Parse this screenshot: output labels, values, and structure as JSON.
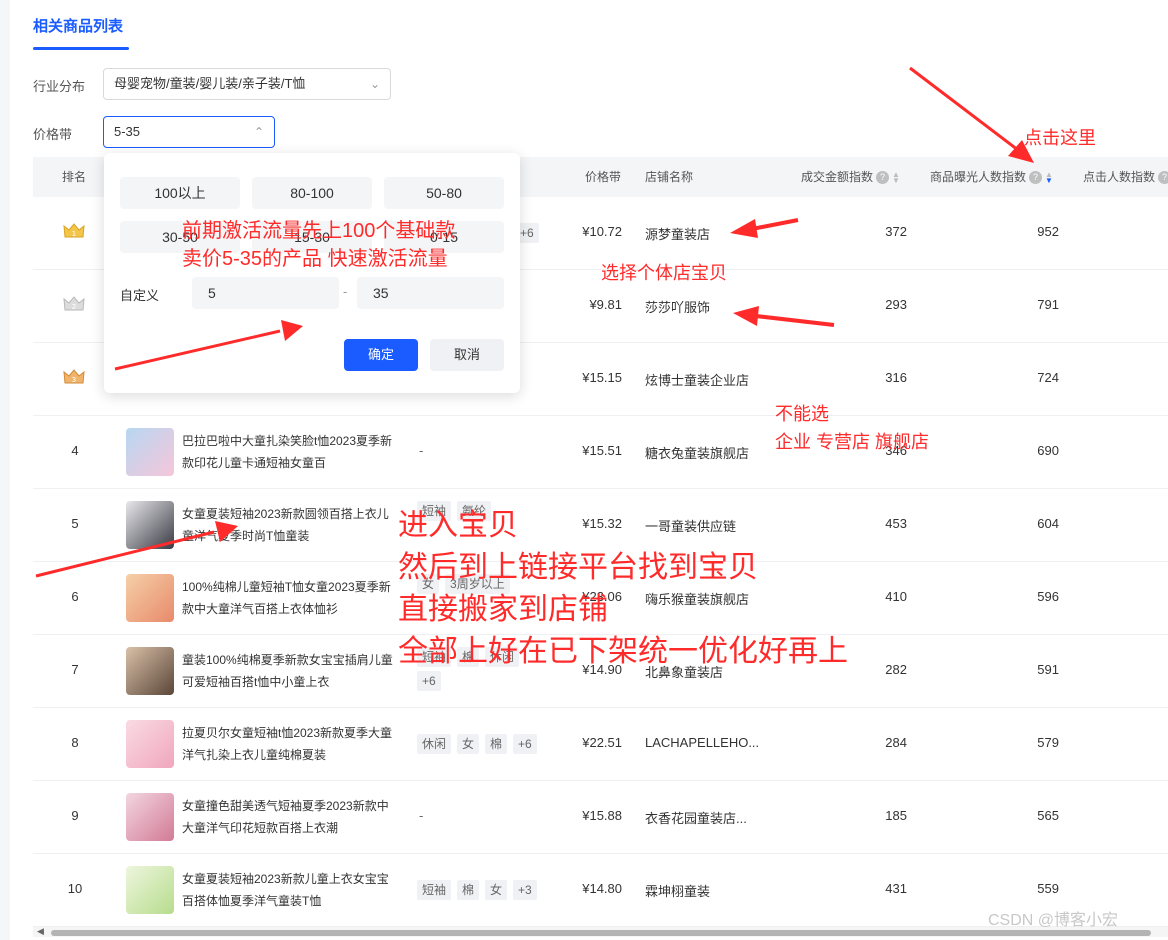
{
  "tab": {
    "label": "相关商品列表"
  },
  "filters": {
    "industry": {
      "label": "行业分布",
      "value": "母婴宠物/童装/婴儿装/亲子装/T恤"
    },
    "price": {
      "label": "价格带",
      "value": "5-35"
    }
  },
  "columns": {
    "rank": "排名",
    "price": "价格带",
    "shop": "店铺名称",
    "gmv": "成交金额指数",
    "exposure": "商品曝光人数指数",
    "clicks": "点击人数指数"
  },
  "rows": [
    {
      "rank": "1",
      "title": "",
      "tags": [
        "+6"
      ],
      "price": "¥10.72",
      "shop": "源梦童装店",
      "gmv": "372",
      "exposure": "952"
    },
    {
      "rank": "2",
      "title": "",
      "tags": [],
      "price": "¥9.81",
      "shop": "莎莎吖服饰",
      "gmv": "293",
      "exposure": "791"
    },
    {
      "rank": "3",
      "title": "",
      "tags": [],
      "price": "¥15.15",
      "shop": "炫博士童装企业店",
      "gmv": "316",
      "exposure": "724"
    },
    {
      "rank": "4",
      "title": "巴拉巴啦中大童扎染笑脸t恤2023夏季新款印花儿童卡通短袖女童百",
      "tags": [],
      "price": "¥15.51",
      "shop": "糖衣兔童装旗舰店",
      "gmv": "346",
      "exposure": "690"
    },
    {
      "rank": "5",
      "title": "女童夏装短袖2023新款圆领百搭上衣儿童洋气夏季时尚T恤童装",
      "tags": [
        "短袖",
        "氨纶"
      ],
      "price": "¥15.32",
      "shop": "一哥童装供应链",
      "gmv": "453",
      "exposure": "604"
    },
    {
      "rank": "6",
      "title": "100%纯棉儿童短袖T恤女童2023夏季新款中大童洋气百搭上衣体恤衫",
      "tags": [
        "女",
        "3周岁以上"
      ],
      "price": "¥23.06",
      "shop": "嗨乐猴童装旗舰店",
      "gmv": "410",
      "exposure": "596"
    },
    {
      "rank": "7",
      "title": "童装100%纯棉夏季新款女宝宝插肩儿童可爱短袖百搭t恤中小童上衣",
      "tags": [
        "短袖",
        "棉",
        "休闲"
      ],
      "price": "¥14.90",
      "shop": "北鼻象童装店",
      "gmv": "282",
      "exposure": "591"
    },
    {
      "rank": "8",
      "title": "拉夏贝尔女童短袖t恤2023新款夏季大童洋气扎染上衣儿童纯棉夏装",
      "tags": [
        "休闲",
        "女",
        "棉",
        "+6"
      ],
      "price": "¥22.51",
      "shop": "LACHAPELLEHO...",
      "gmv": "284",
      "exposure": "579"
    },
    {
      "rank": "9",
      "title": "女童撞色甜美透气短袖夏季2023新款中大童洋气印花短款百搭上衣潮",
      "tags": [],
      "price": "¥15.88",
      "shop": "衣香花园童装店...",
      "gmv": "185",
      "exposure": "565"
    },
    {
      "rank": "10",
      "title": "女童夏装短袖2023新款儿童上衣女宝宝百搭体恤夏季洋气童装T恤",
      "tags": [
        "短袖",
        "棉",
        "女",
        "+3"
      ],
      "price": "¥14.80",
      "shop": "霖坤栩童装",
      "gmv": "431",
      "exposure": "559"
    }
  ],
  "price_popup": {
    "options": [
      "100以上",
      "80-100",
      "50-80",
      "30-50",
      "15-30",
      "0-15"
    ],
    "custom_label": "自定义",
    "min_value": "5",
    "max_value": "35",
    "separator": "-",
    "confirm": "确定",
    "cancel": "取消"
  },
  "annotations": {
    "click_here": "点击这里",
    "step1_line1": "前期激活流量先上100个基础款",
    "step1_line2": "卖价5-35的产品 快速激活流量",
    "choose_shop": "选择个体店宝贝",
    "no_select_line1": "不能选",
    "no_select_line2": "企业 专营店  旗舰店",
    "step2_line1": "进入宝贝",
    "step2_line2": "然后到上链接平台找到宝贝",
    "step2_line3": "直接搬家到店铺",
    "step2_line4": "全部上好在已下架统一优化好再上"
  },
  "watermark": "CSDN @博客小宏",
  "colors": {
    "accent": "#1a5cff",
    "annotation": "#ff2a2a"
  }
}
